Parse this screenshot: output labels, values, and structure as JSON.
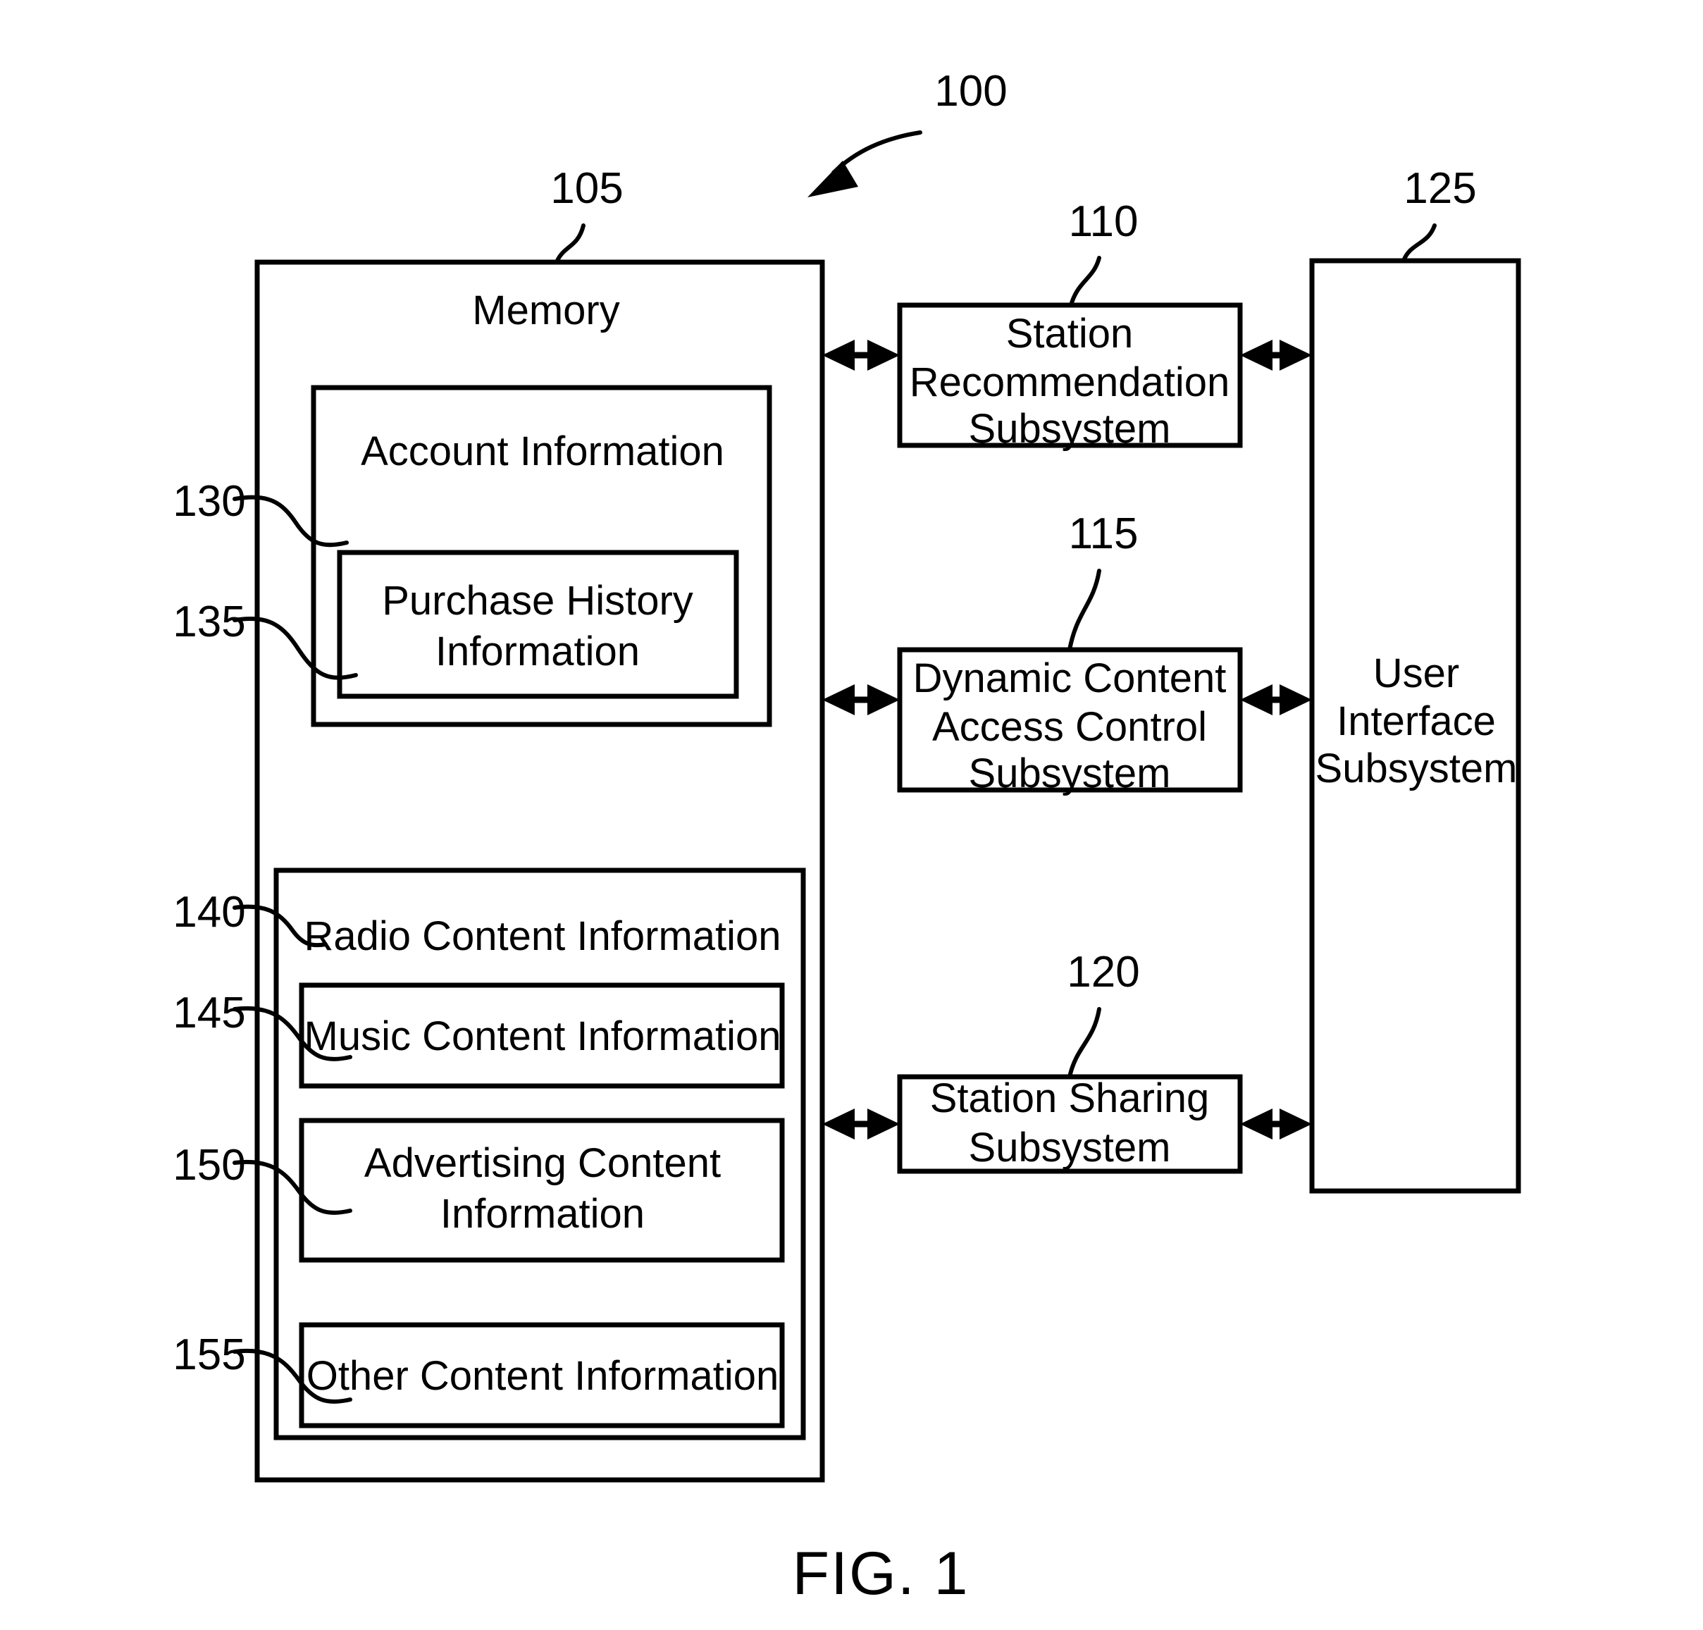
{
  "figure": {
    "caption": "FIG. 1",
    "system_ref": "100"
  },
  "memory": {
    "ref": "105",
    "label": "Memory",
    "children": [
      {
        "ref": "130",
        "label": "Account Information",
        "children": [
          {
            "ref": "135",
            "label_line1": "Purchase History",
            "label_line2": "Information"
          }
        ]
      },
      {
        "ref": "140",
        "label": "Radio Content Information",
        "children": [
          {
            "ref": "145",
            "label": "Music Content Information"
          },
          {
            "ref": "150",
            "label_line1": "Advertising Content",
            "label_line2": "Information"
          },
          {
            "ref": "155",
            "label": "Other Content Information"
          }
        ]
      }
    ]
  },
  "subsystems": [
    {
      "ref": "110",
      "label_line1": "Station",
      "label_line2": "Recommendation",
      "label_line3": "Subsystem"
    },
    {
      "ref": "115",
      "label_line1": "Dynamic Content",
      "label_line2": "Access Control",
      "label_line3": "Subsystem"
    },
    {
      "ref": "120",
      "label_line1": "Station Sharing",
      "label_line2": "Subsystem",
      "label_line3": ""
    }
  ],
  "user_interface": {
    "ref": "125",
    "label_line1": "User",
    "label_line2": "Interface",
    "label_line3": "Subsystem"
  },
  "colors": {
    "stroke": "#000000",
    "background": "#ffffff"
  }
}
